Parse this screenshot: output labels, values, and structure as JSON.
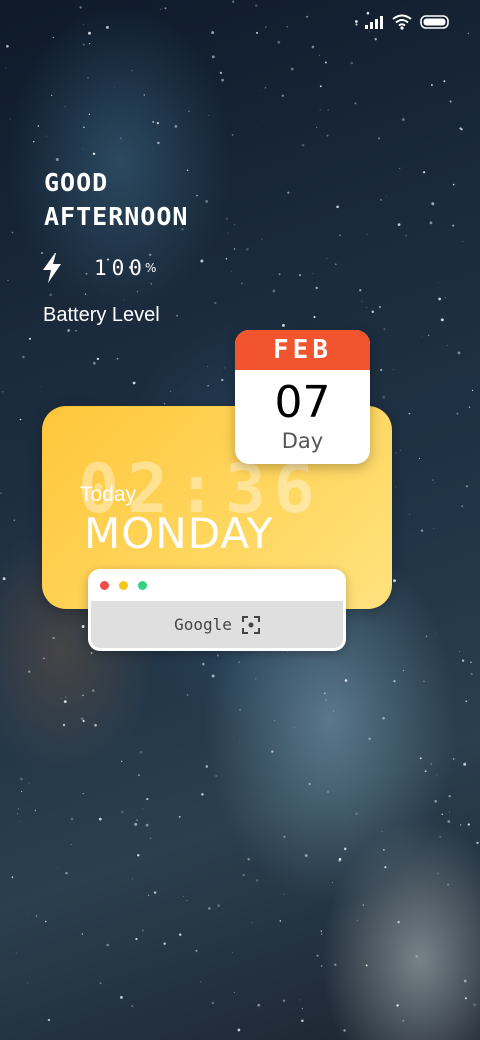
{
  "status_bar": {
    "icons": [
      "signal-icon",
      "wifi-icon",
      "battery-icon"
    ]
  },
  "greeting": {
    "line1": "GOOD",
    "line2": "AFTERNOON"
  },
  "battery": {
    "value": "100",
    "unit": "%",
    "label": "Battery Level",
    "icon": "lightning-icon"
  },
  "clock_card": {
    "time": "02:36",
    "today_label": "Today",
    "day": "MONDAY"
  },
  "calendar": {
    "month": "FEB",
    "date": "07",
    "sub_label": "Day"
  },
  "browser_widget": {
    "dot_colors": [
      "#f14c4c",
      "#f5c518",
      "#35d07f"
    ],
    "search_label": "Google",
    "scan_icon": "scan-icon"
  },
  "colors": {
    "card_yellow": "#ffc63a",
    "calendar_red": "#f2542d"
  }
}
